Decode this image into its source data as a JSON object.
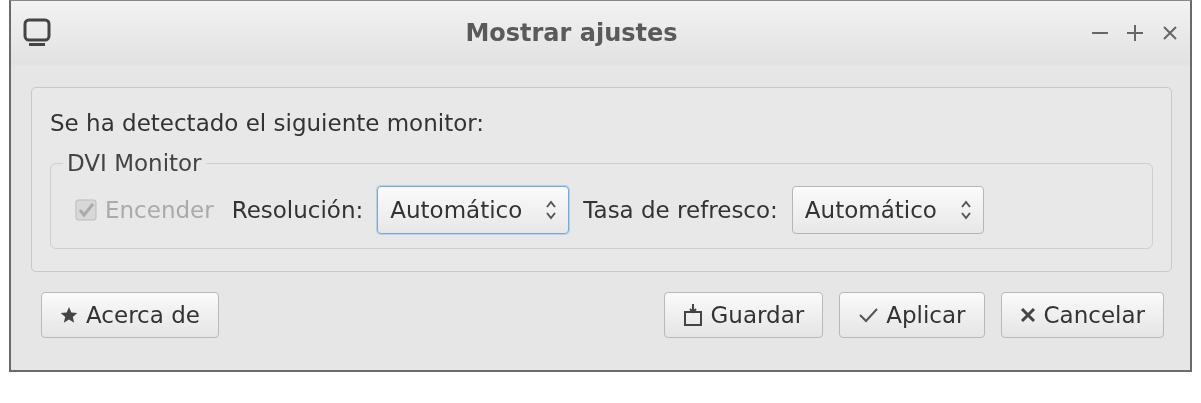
{
  "window": {
    "title": "Mostrar ajustes"
  },
  "content": {
    "message": "Se ha detectado el siguiente monitor:",
    "monitor": {
      "name": "DVI Monitor",
      "power": {
        "label": "Encender",
        "checked": true,
        "disabled": true
      },
      "resolution": {
        "label": "Resolución:",
        "value": "Automático",
        "focused": true
      },
      "refresh_rate": {
        "label": "Tasa de refresco:",
        "value": "Automático",
        "focused": false
      }
    }
  },
  "buttons": [
    {
      "label": "Acerca de",
      "kind": "about"
    },
    {
      "label": "Guardar",
      "kind": "save"
    },
    {
      "label": "Aplicar",
      "kind": "apply"
    },
    {
      "label": "Cancelar",
      "kind": "cancel"
    }
  ]
}
